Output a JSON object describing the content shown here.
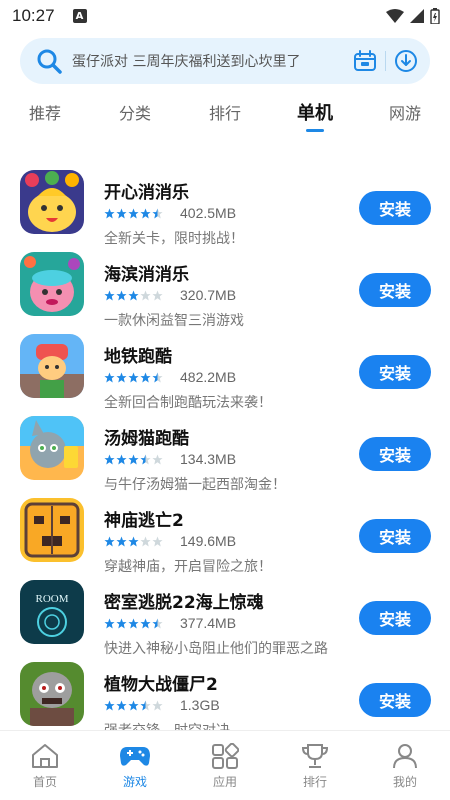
{
  "status_bar": {
    "time": "10:27"
  },
  "search": {
    "placeholder_text": "蛋仔派对  三周年庆福利送到心坎里了"
  },
  "tabs": [
    {
      "label": "推荐",
      "active": false
    },
    {
      "label": "分类",
      "active": false
    },
    {
      "label": "排行",
      "active": false
    },
    {
      "label": "单机",
      "active": true
    },
    {
      "label": "网游",
      "active": false
    }
  ],
  "apps": [
    {
      "name": "开心消消乐",
      "rating": 4.5,
      "size": "402.5MB",
      "desc": "全新关卡，限时挑战！",
      "install_label": "安装"
    },
    {
      "name": "海滨消消乐",
      "rating": 3,
      "size": "320.7MB",
      "desc": "一款休闲益智三消游戏",
      "install_label": "安装"
    },
    {
      "name": "地铁跑酷",
      "rating": 4.5,
      "size": "482.2MB",
      "desc": "全新回合制跑酷玩法来袭！",
      "install_label": "安装"
    },
    {
      "name": "汤姆猫跑酷",
      "rating": 3.5,
      "size": "134.3MB",
      "desc": "与牛仔汤姆猫一起西部淘金！",
      "install_label": "安装"
    },
    {
      "name": "神庙逃亡2",
      "rating": 3,
      "size": "149.6MB",
      "desc": "穿越神庙，开启冒险之旅！",
      "install_label": "安装"
    },
    {
      "name": "密室逃脱22海上惊魂",
      "rating": 4.5,
      "size": "377.4MB",
      "desc": "快进入神秘小岛阻止他们的罪恶之路",
      "install_label": "安装"
    },
    {
      "name": "植物大战僵尸2",
      "rating": 3.5,
      "size": "1.3GB",
      "desc": "强者交锋，时空对决",
      "install_label": "安装"
    }
  ],
  "room_icon_text": "ROOM",
  "bottom_nav": [
    {
      "label": "首页",
      "icon": "home-icon",
      "active": false
    },
    {
      "label": "游戏",
      "icon": "gamepad-icon",
      "active": true
    },
    {
      "label": "应用",
      "icon": "apps-icon",
      "active": false
    },
    {
      "label": "排行",
      "icon": "trophy-icon",
      "active": false
    },
    {
      "label": "我的",
      "icon": "user-icon",
      "active": false
    }
  ],
  "colors": {
    "accent": "#1e88e5",
    "button": "#1a82f0",
    "search_bg": "#e6f3fd",
    "star": "#1e88e5"
  }
}
